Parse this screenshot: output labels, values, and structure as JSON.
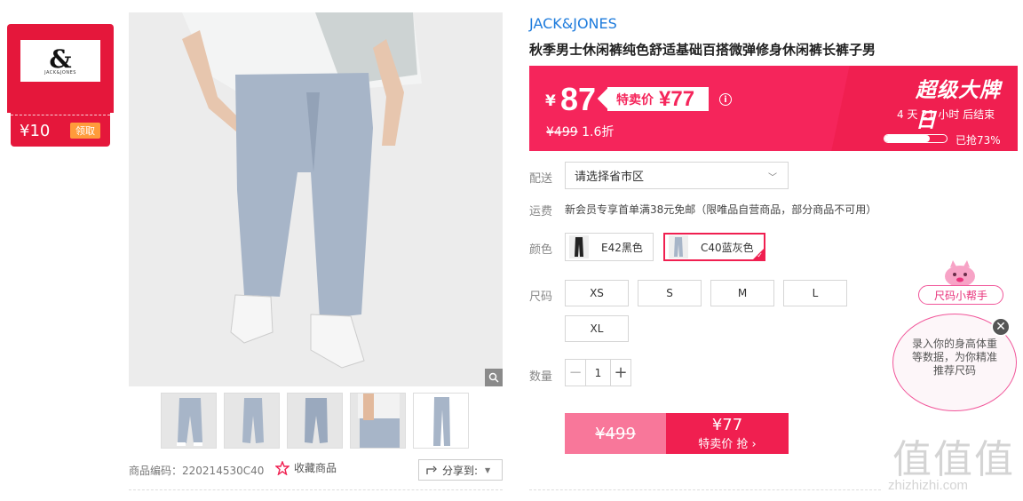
{
  "coupon": {
    "amount": "¥10",
    "claim_label": "领取",
    "logo_mark": "&",
    "logo_text": "JACK&JONES"
  },
  "gallery": {
    "thumbnails": [
      "pants-front",
      "pants-side",
      "pants-back",
      "pants-detail",
      "pants-flat"
    ]
  },
  "meta": {
    "sku_label": "商品编码：",
    "sku_value": "220214530C40",
    "fav_label": "收藏商品",
    "share_label": "分享到:"
  },
  "product": {
    "brand": "JACK&JONES",
    "title": "秋季男士休闲裤纯色舒适基础百搭微弹修身休闲裤长裤子男"
  },
  "price": {
    "currency": "¥",
    "current": "87",
    "special_label": "特卖价",
    "special_value": "¥77",
    "info": "i",
    "original": "¥499",
    "discount": "1.6折"
  },
  "event": {
    "title": "超级大牌日",
    "countdown": "4 天 21 小时 后结束",
    "sold_percent": 0.73,
    "sold_label": "已抢73%"
  },
  "delivery": {
    "label": "配送",
    "placeholder": "请选择省市区"
  },
  "shipping": {
    "label": "运费",
    "text": "新会员专享首单满38元免邮（限唯品自营商品，部分商品不可用）"
  },
  "colors": {
    "label": "颜色",
    "options": [
      {
        "name": "E42黑色",
        "selected": false
      },
      {
        "name": "C40蓝灰色",
        "selected": true
      }
    ]
  },
  "sizes": {
    "label": "尺码",
    "options": [
      "XS",
      "S",
      "M",
      "L",
      "XL"
    ]
  },
  "quantity": {
    "label": "数量",
    "value": "1",
    "minus": "−",
    "plus": "+"
  },
  "buy": {
    "original": "¥499",
    "price": "¥77",
    "action": "特卖价 抢 ›"
  },
  "helper": {
    "title": "尺码小帮手",
    "text": "录入你的身高体重等数据，为你精准推荐尺码",
    "close": "✕"
  },
  "watermark": {
    "logo": "值值值",
    "url": "zhizhizhi.com"
  },
  "colors_theme": {
    "accent": "#f01f50",
    "brand_blue": "#1d7bdc",
    "coupon_red": "#e5173b",
    "pants": "#a7b5c8"
  }
}
